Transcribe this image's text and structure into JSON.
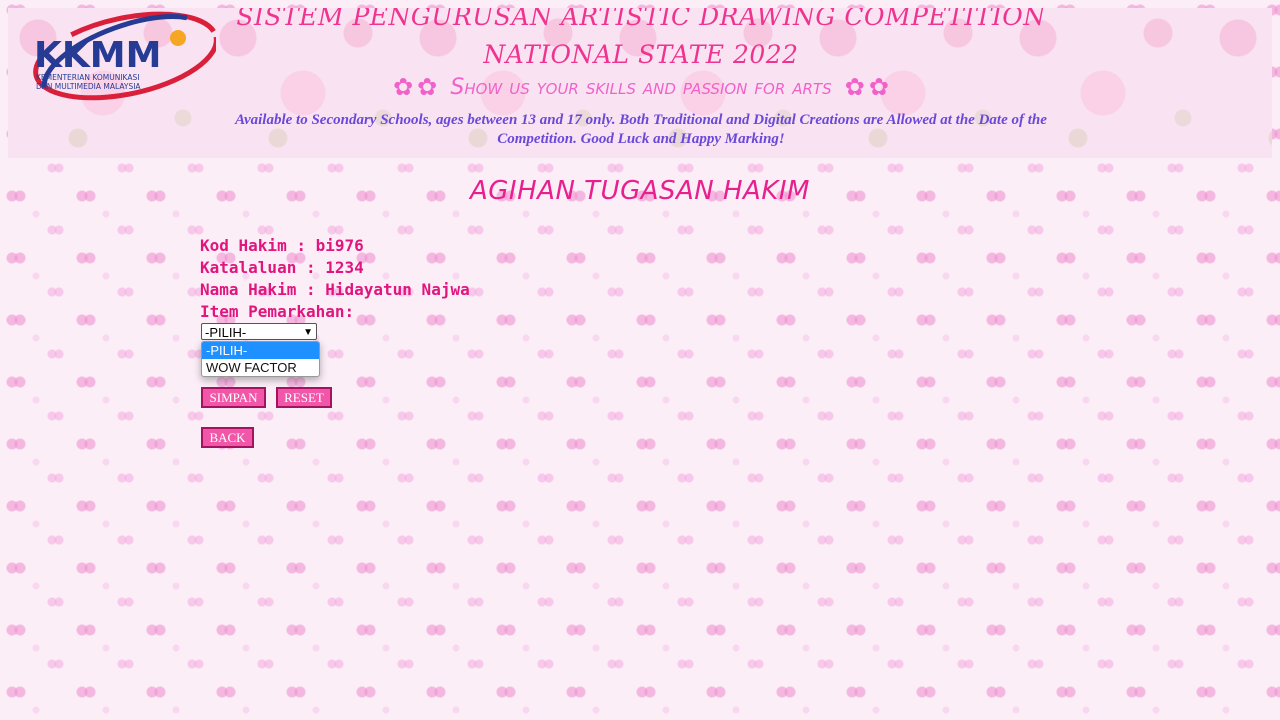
{
  "header": {
    "logo": {
      "brand": "KKMM",
      "line1": "KEMENTERIAN KOMUNIKASI",
      "line2": "DAN MULTIMEDIA MALAYSIA",
      "colors": {
        "blue": "#263b93",
        "red": "#d91f3a",
        "orange": "#f5a623"
      }
    },
    "title_line1": "SISTEM PENGURUSAN ARTISTIC DRAWING COMPETITION",
    "title_line2": "NATIONAL STATE 2022",
    "tagline": "Show us your skills and passion for arts",
    "info": "Available to Secondary Schools, ages between 13 and 17 only. Both Traditional and Digital Creations are Allowed at the Date of the Competition. Good Luck and Happy Marking!"
  },
  "page": {
    "heading": "AGIHAN TUGASAN HAKIM"
  },
  "form": {
    "kod_hakim": "Kod Hakim : bi976",
    "katalaluan": "Katalaluan : 1234",
    "nama_hakim": "Nama Hakim : Hidayatun Najwa",
    "item_label": "Item Pemarkahan:",
    "select_value": "-PILIH-",
    "options": [
      "-PILIH-",
      "WOW FACTOR"
    ],
    "save_label": "SIMPAN",
    "reset_label": "RESET",
    "back_label": "BACK"
  },
  "colors": {
    "heading_pink": "#e8208e",
    "field_pink": "#e0157e",
    "info_purple": "#6a48d8",
    "button_pink": "#f256a8",
    "button_border": "#a3135f",
    "option_highlight": "#1e90ff"
  }
}
